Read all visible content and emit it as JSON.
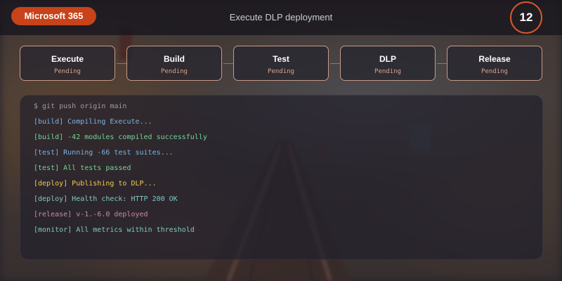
{
  "header": {
    "brand": "Microsoft 365",
    "title": "Execute DLP deployment",
    "counter": "12"
  },
  "stages": [
    {
      "name": "Execute",
      "status": "Pending"
    },
    {
      "name": "Build",
      "status": "Pending"
    },
    {
      "name": "Test",
      "status": "Pending"
    },
    {
      "name": "DLP",
      "status": "Pending"
    },
    {
      "name": "Release",
      "status": "Pending"
    }
  ],
  "terminal": {
    "lines": [
      {
        "text": "$ git push origin main",
        "color": "#9a9aa6"
      },
      {
        "text": "[build] Compiling Execute...",
        "color": "#7bb3e0"
      },
      {
        "text": "[build] -42 modules compiled successfully",
        "color": "#74d49a"
      },
      {
        "text": "[test] Running -66 test suites...",
        "color": "#7bb3e0"
      },
      {
        "text": "[test] All tests passed",
        "color": "#74d49a"
      },
      {
        "text": "[deploy] Publishing to DLP...",
        "color": "#f2c94c"
      },
      {
        "text": "[deploy] Health check: HTTP 200 OK",
        "color": "#7fc9c2"
      },
      {
        "text": "[release] v-1.-6.0 deployed",
        "color": "#c98aa8"
      },
      {
        "text": "[monitor] All metrics within threshold",
        "color": "#7fc9c2"
      }
    ]
  },
  "colors": {
    "brand_accent": "#c8431a",
    "counter_ring": "#d8582b",
    "stage_border": "#c79986",
    "stage_status": "#d9a48e"
  }
}
